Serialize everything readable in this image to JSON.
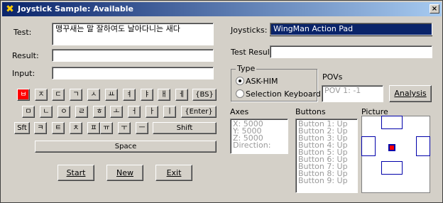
{
  "window": {
    "title": "Joystick Sample: Available",
    "close_label": "×"
  },
  "left": {
    "test_label": "Test:",
    "test_value": "맹꾸새는 말 잘하여도 날아다니는 새다",
    "result_label": "Result:",
    "result_value": "",
    "input_label": "Input:",
    "input_value": ""
  },
  "keyboard": {
    "row1": [
      "ㅂ",
      "ㅈ",
      "ㄷ",
      "ㄱ",
      "ㅅ",
      "ㅛ",
      "ㅕ",
      "ㅑ",
      "ㅐ",
      "ㅔ",
      "{BS}"
    ],
    "row2": [
      "ㅁ",
      "ㄴ",
      "ㅇ",
      "ㄹ",
      "ㅎ",
      "ㅗ",
      "ㅓ",
      "ㅏ",
      "ㅣ",
      "{Enter}"
    ],
    "row3": [
      "Sft",
      "ㅋ",
      "ㅌ",
      "ㅊ",
      "ㅍ",
      "ㅠ",
      "ㅜ",
      "ㅡ",
      "Shift"
    ],
    "space": "Space",
    "active_key": "ㅂ",
    "active_color": "#ff0000"
  },
  "buttons": {
    "start": "Start",
    "new": "New",
    "exit": "Exit",
    "analysis": "Analysis"
  },
  "right": {
    "joysticks_label": "Joysticks:",
    "joysticks_value": "WingMan Action Pad",
    "test_result_label": "Test Result:",
    "test_result_value": "",
    "type_group": "Type",
    "type_options": [
      "ASK-HIM",
      "Selection Keyboard"
    ],
    "type_selected": "ASK-HIM",
    "povs_label": "POVs",
    "pov_value": "POV 1: -1",
    "axes_label": "Axes",
    "axes_lines": [
      "X: 5000",
      "Y: 5000",
      "Z: 5000",
      "Direction:"
    ],
    "buttons_label": "Buttons",
    "button_lines": [
      "Button 1: Up",
      "Button 2: Up",
      "Button 3: Up",
      "Button 4: Up",
      "Button 5: Up",
      "Button 6: Up",
      "Button 7: Up",
      "Button 8: Up",
      "Button 9: Up"
    ],
    "picture_label": "Picture"
  },
  "colors": {
    "title_start": "#0a246a",
    "title_end": "#a6caf0",
    "selection": "#0a246a",
    "pad_outline": "#0000aa"
  }
}
